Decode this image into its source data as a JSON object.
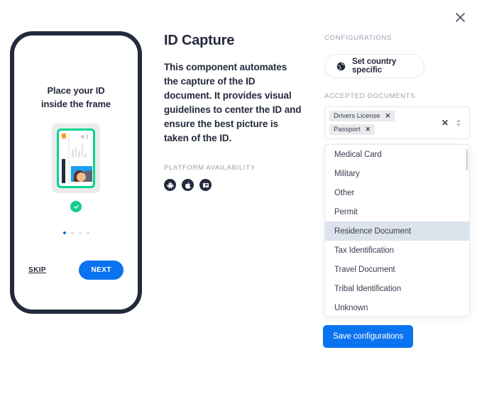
{
  "window": {
    "close_label": "×"
  },
  "phone_preview": {
    "headline_line1": "Place your ID",
    "headline_line2": "inside the frame",
    "card_illustration": {
      "frame_color": "#00d68f",
      "accent_orange": "#f0a623",
      "photo_bg": "#1ea0f0",
      "check_color": "#15cc8b"
    },
    "pagination": {
      "total": 4,
      "active_index": 0,
      "active_color": "#0a74f0",
      "inactive_color": "#dcdfe5"
    },
    "skip_label": "SKIP",
    "next_label": "NEXT"
  },
  "detail": {
    "title": "ID Capture",
    "description": "This component automates the capture of the ID document. It provides visual guidelines to center the ID and ensure the best picture is taken of the ID.",
    "platform_label": "PLATFORM AVAILABILITY",
    "platforms": [
      {
        "name": "android-icon",
        "label": "Android"
      },
      {
        "name": "apple-icon",
        "label": "iOS"
      },
      {
        "name": "web-icon",
        "label": "Web"
      }
    ]
  },
  "configurations": {
    "section_label": "CONFIGURATIONS",
    "country_button_label": "Set country specific",
    "country_button_icon": "globe-icon"
  },
  "accepted_documents": {
    "section_label": "ACCEPTED DOCUMENTS",
    "selected": [
      {
        "label": "Drivers License",
        "remove_label": "✕"
      },
      {
        "label": "Passport",
        "remove_label": "✕"
      }
    ],
    "clear_label": "✕",
    "options": [
      {
        "label": "Medical Card",
        "highlighted": false
      },
      {
        "label": "Military",
        "highlighted": false
      },
      {
        "label": "Other",
        "highlighted": false
      },
      {
        "label": "Permit",
        "highlighted": false
      },
      {
        "label": "Residence Document",
        "highlighted": true
      },
      {
        "label": "Tax Identification",
        "highlighted": false
      },
      {
        "label": "Travel Document",
        "highlighted": false
      },
      {
        "label": "Tribal Identification",
        "highlighted": false
      },
      {
        "label": "Unknown",
        "highlighted": false
      }
    ]
  },
  "footer": {
    "save_label": "Save configurations",
    "save_color": "#0a74f0"
  }
}
